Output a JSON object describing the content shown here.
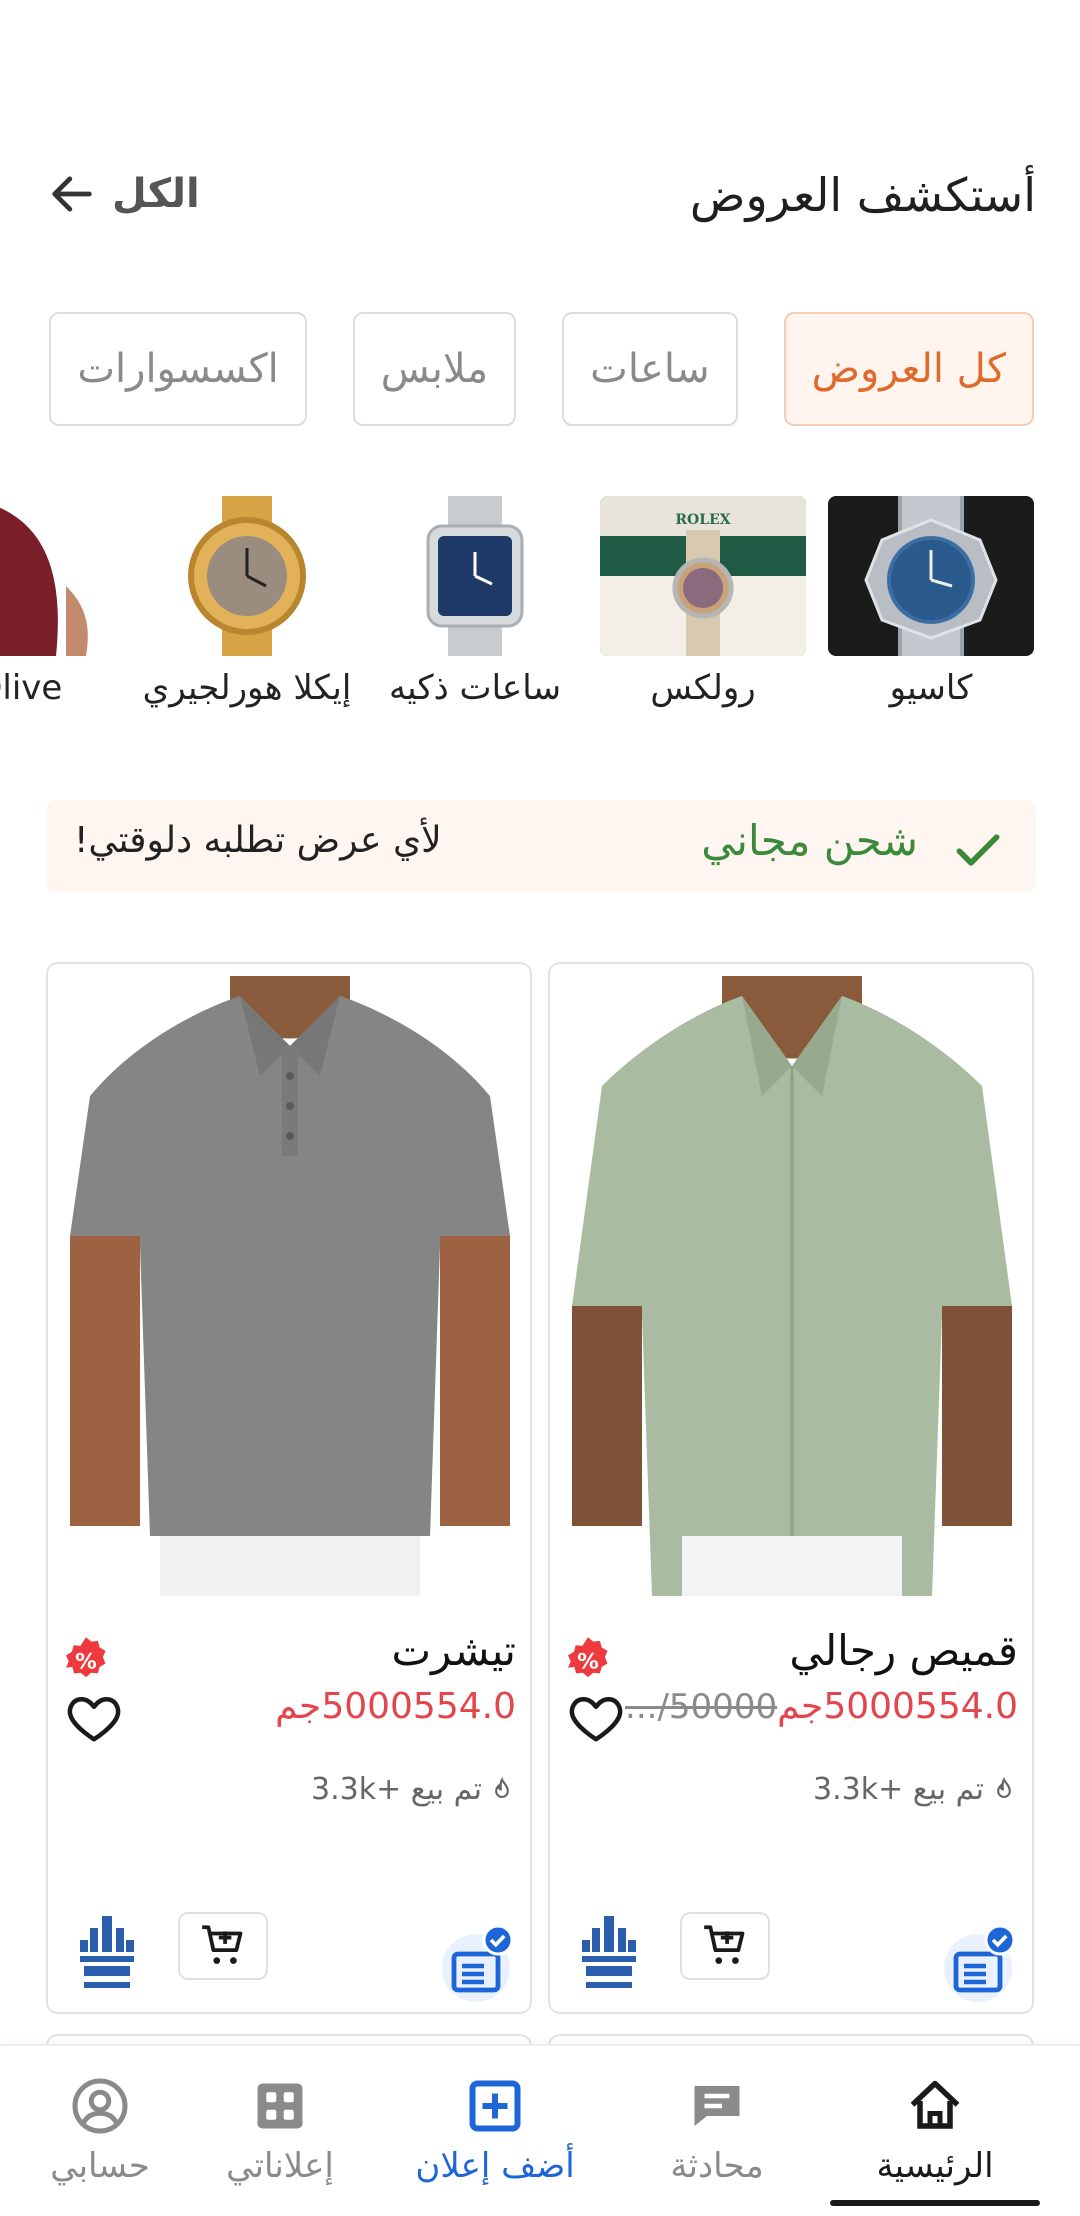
{
  "header": {
    "title": "أستكشف العروض",
    "see_all": "الكل"
  },
  "chips": [
    {
      "label": "كل العروض",
      "active": true
    },
    {
      "label": "ساعات",
      "active": false
    },
    {
      "label": "ملابس",
      "active": false
    },
    {
      "label": "اكسسوارات",
      "active": false
    }
  ],
  "brands": [
    {
      "label": "كاسيو"
    },
    {
      "label": "رولكس"
    },
    {
      "label": "ساعات ذكيه"
    },
    {
      "label": "إيكلا هورلجيري"
    },
    {
      "label": "Olive"
    }
  ],
  "shipping": {
    "title": "شحن مجاني",
    "subtitle": "لأي عرض تطلبه دلوقتي!"
  },
  "products": [
    {
      "title": "قميص رجالي",
      "price": "5000554.0جم",
      "old_price": "50000/...",
      "sold": "تم بيع +3.3k"
    },
    {
      "title": "تيشرت",
      "price": "5000554.0جم",
      "old_price": "",
      "sold": "تم بيع +3.3k"
    }
  ],
  "nav": {
    "home": "الرئيسية",
    "chat": "محادثة",
    "add": "أضف إعلان",
    "my_ads": "إعلاناتي",
    "account": "حسابي"
  },
  "colors": {
    "accent_orange": "#e06a2c",
    "price_red": "#e4444c",
    "brand_blue": "#1e66d8",
    "ship_green": "#3b8a3b"
  }
}
